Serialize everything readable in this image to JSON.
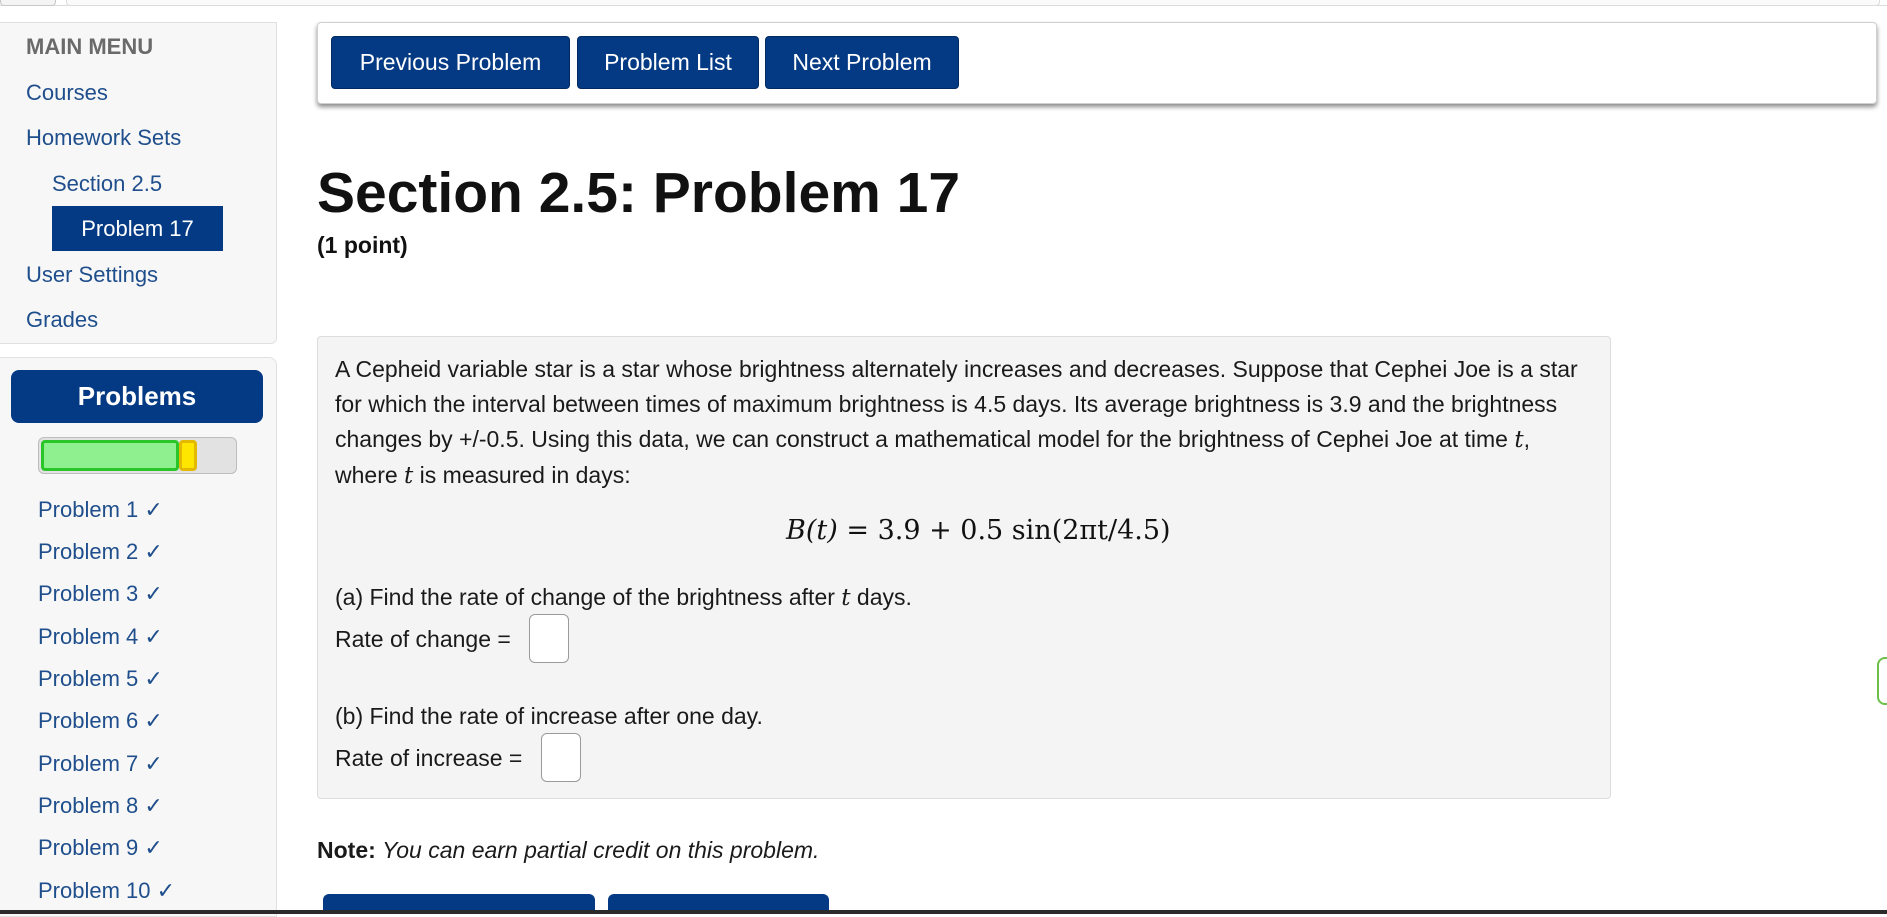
{
  "sidebar": {
    "heading": "MAIN MENU",
    "courses": "Courses",
    "homework_sets": "Homework Sets",
    "section": "Section 2.5",
    "current_problem": "Problem 17",
    "user_settings": "User Settings",
    "grades": "Grades"
  },
  "problems_panel": {
    "title": "Problems",
    "progress": {
      "correct_fraction": 0.71,
      "partial_fraction": 0.09,
      "correct_color": "#8ef08e",
      "partial_color": "#ffe600"
    },
    "items": [
      "Problem 1 ✓",
      "Problem 2 ✓",
      "Problem 3 ✓",
      "Problem 4 ✓",
      "Problem 5 ✓",
      "Problem 6 ✓",
      "Problem 7 ✓",
      "Problem 8 ✓",
      "Problem 9 ✓",
      "Problem 10 ✓"
    ]
  },
  "nav": {
    "previous": "Previous Problem",
    "list": "Problem List",
    "next": "Next Problem"
  },
  "problem": {
    "title": "Section 2.5: Problem 17",
    "points": "(1 point)",
    "intro": "A Cepheid variable star is a star whose brightness alternately increases and decreases. Suppose that Cephei Joe is a star for which the interval between times of maximum brightness is 4.5 days. Its average brightness is 3.9 and the brightness changes by +/-0.5. Using this data, we can construct a mathematical model for the brightness of Cephei Joe at time ",
    "intro_var1": "t",
    "intro_mid": ", where ",
    "intro_var2": "t",
    "intro_end": " is measured in days:",
    "formula": {
      "lhs": "B(t)",
      "eq": " = ",
      "rhs": "3.9 + 0.5 sin(2πt/4.5)"
    },
    "part_a_pre": "(a) Find the rate of change of the brightness after ",
    "part_a_var": "t",
    "part_a_post": " days.",
    "part_a_label": "Rate of change =",
    "part_a_value": "",
    "part_b": "(b) Find the rate of increase after one day.",
    "part_b_label": "Rate of increase =",
    "part_b_value": ""
  },
  "note": {
    "label": "Note:",
    "text": "You can earn partial credit on this problem."
  },
  "colors": {
    "primary": "#043a84",
    "link": "#1f4e8c",
    "problem_bg": "#f4f4f4"
  }
}
